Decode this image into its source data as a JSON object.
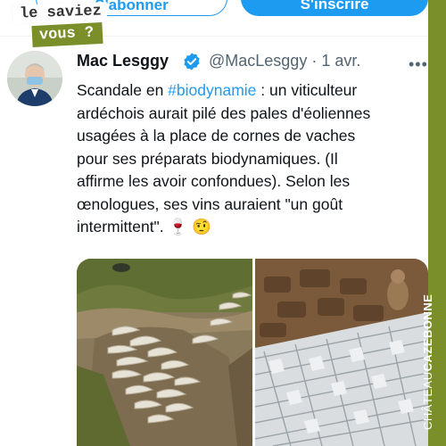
{
  "top_bar": {
    "follow_label": "S'abonner",
    "signup_label": "S'inscrire"
  },
  "sticker": {
    "line1": "le saviez",
    "line2": "vous ?"
  },
  "brand": {
    "prefix": "CHÂTEAU",
    "name": "CAZEBONNE"
  },
  "tweet": {
    "author_name": "Mac Lesggy",
    "handle_date": "@MacLesggy · 1 avr.",
    "more": "•••",
    "lines": [
      {
        "pre": "Scandale en ",
        "hashtag": "#biodynamie",
        "post": " : un viticulteur"
      },
      {
        "text": "ardéchois aurait pilé des pales d'éoliennes"
      },
      {
        "text": "usagées à la place de cornes de vaches"
      },
      {
        "text": "pour ses préparats biodynamiques.  (Il"
      },
      {
        "text": "affirme les avoir confondues). Selon les"
      },
      {
        "text": "œnologues, ses vins auraient \"un goût"
      },
      {
        "text": "intermittent\". 🍷 🤨"
      }
    ]
  },
  "colors": {
    "accent": "#1d9bf0",
    "brand_green": "#7a8f2a",
    "text": "#0f1419",
    "muted": "#536471"
  },
  "icons": {
    "verified": "verified-badge-icon",
    "more": "more-options-icon"
  },
  "media": {
    "left": "horns-in-soil-photo",
    "right": "turbine-blades-in-soil-photo"
  }
}
